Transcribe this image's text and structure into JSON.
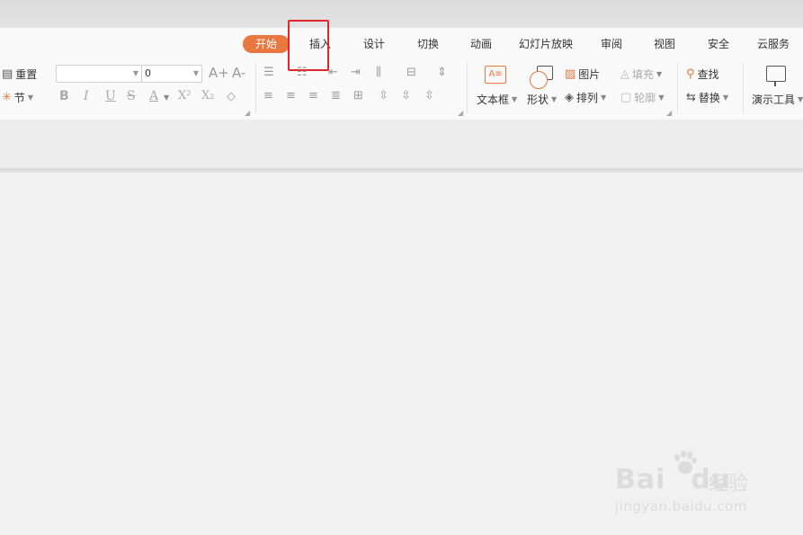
{
  "tabs": [
    "开始",
    "插入",
    "设计",
    "切换",
    "动画",
    "幻灯片放映",
    "审阅",
    "视图",
    "安全",
    "云服务"
  ],
  "active_tab": "开始",
  "highlighted_tab": "插入",
  "slides_group": {
    "reset_label": "重置",
    "section_label": "节"
  },
  "font_group": {
    "font_name": "",
    "font_size": "0",
    "grow_label": "A+",
    "shrink_label": "A-"
  },
  "format": {
    "bold": "B",
    "italic": "I",
    "underline": "U",
    "strike": "S",
    "font_color": "A",
    "superscript": "X²",
    "subscript": "X₂"
  },
  "insert_group": {
    "textbox_label": "文本框",
    "shape_label": "形状",
    "picture_label": "图片",
    "arrange_label": "排列",
    "fill_label": "填充",
    "outline_label": "轮廓"
  },
  "edit_group": {
    "find_label": "查找",
    "replace_label": "替换",
    "tools_label": "演示工具"
  },
  "watermark": {
    "brand": "Bai",
    "brand2": "du",
    "cn": "经验",
    "url": "jingyan.baidu.com"
  },
  "colors": {
    "accent": "#e8783f",
    "highlight": "#e3262b"
  }
}
